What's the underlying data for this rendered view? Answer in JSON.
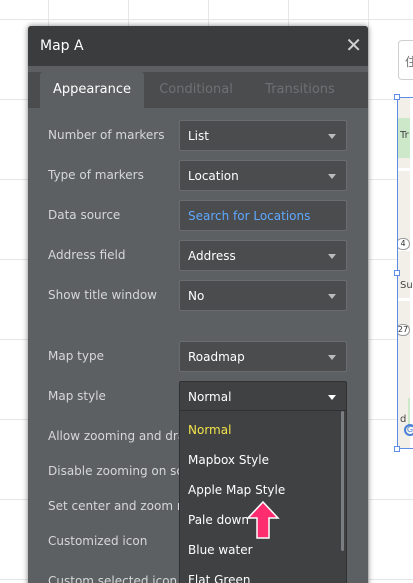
{
  "background": {
    "search_placeholder": "住"
  },
  "panel": {
    "title": "Map A",
    "tabs": [
      {
        "label": "Appearance",
        "active": true
      },
      {
        "label": "Conditional",
        "active": false
      },
      {
        "label": "Transitions",
        "active": false
      }
    ],
    "fields": [
      {
        "label": "Number of markers",
        "value": "List",
        "type": "dropdown"
      },
      {
        "label": "Type of markers",
        "value": "Location",
        "type": "dropdown"
      },
      {
        "label": "Data source",
        "value": "Search for Locations",
        "type": "link"
      },
      {
        "label": "Address field",
        "value": "Address",
        "type": "dropdown"
      },
      {
        "label": "Show title window",
        "value": "No",
        "type": "dropdown"
      },
      {
        "label": "Map type",
        "value": "Roadmap",
        "type": "dropdown"
      },
      {
        "label": "Map style",
        "value": "Normal",
        "type": "dropdown-open"
      },
      {
        "label": "Allow zooming and dragging"
      },
      {
        "label": "Disable zooming on scroll"
      },
      {
        "label": "Set center and zoom manually"
      },
      {
        "label": "Customized icon"
      },
      {
        "label": "Custom selected icon"
      }
    ],
    "map_style_options": [
      {
        "label": "Normal",
        "selected": true
      },
      {
        "label": "Mapbox Style",
        "selected": false
      },
      {
        "label": "Apple Map Style",
        "selected": false
      },
      {
        "label": "Pale down",
        "selected": false
      },
      {
        "label": "Blue water",
        "selected": false
      },
      {
        "label": "Flat Green",
        "selected": false
      }
    ]
  },
  "map_preview": {
    "labels": [
      "Tr",
      "Sum",
      "d"
    ],
    "shields": [
      "4",
      "27"
    ]
  },
  "colors": {
    "panel_bg": "#5d6062",
    "header_bg": "#3a3c3e",
    "selected_option": "#f2e34a",
    "link": "#5fa8ff",
    "arrow": "#ff2d6f",
    "selection_outline": "#5d8ce6"
  }
}
